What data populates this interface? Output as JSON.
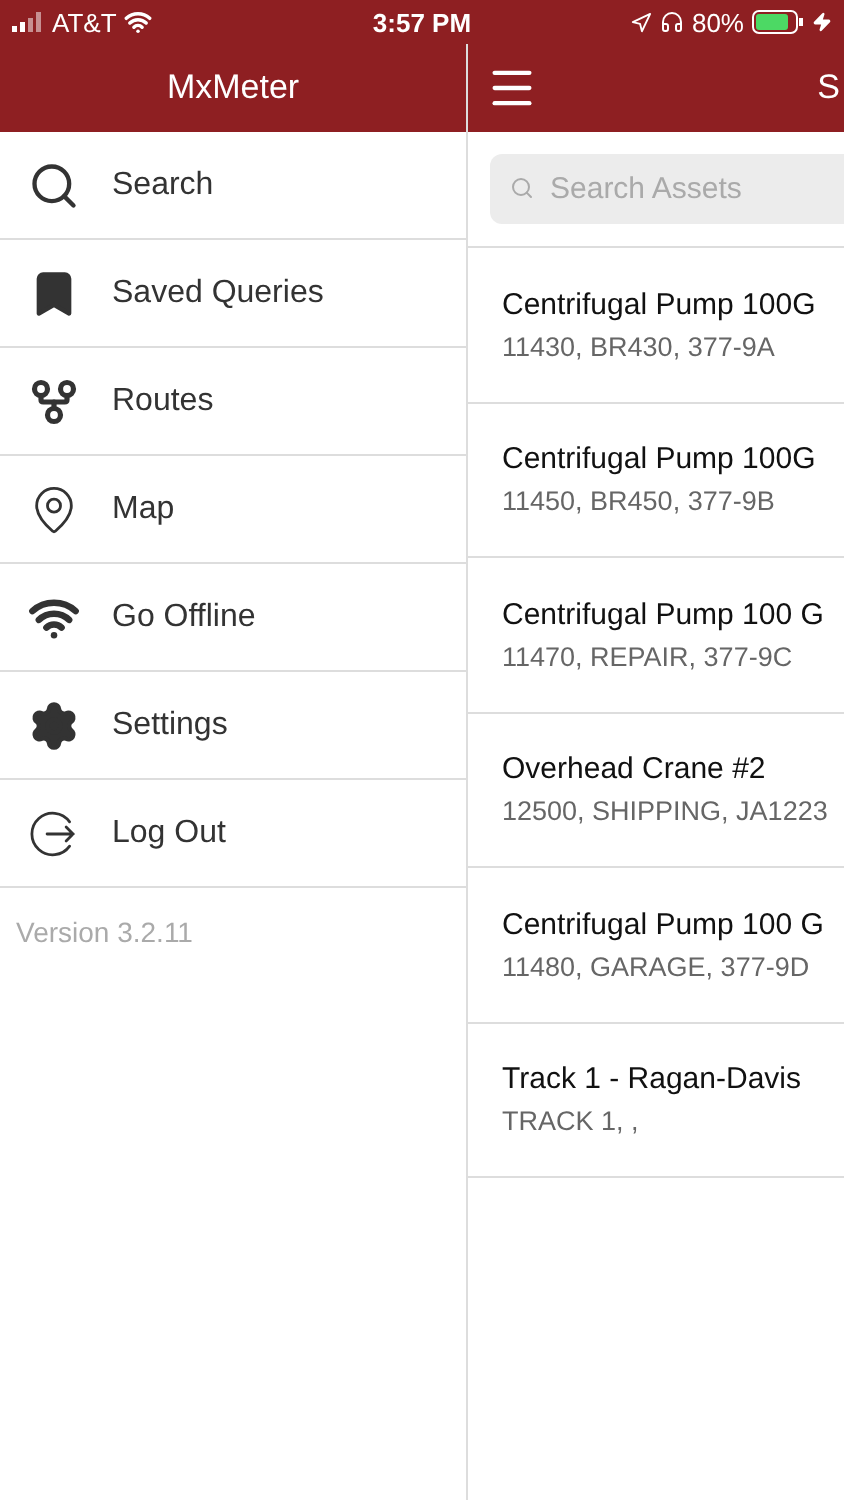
{
  "status_bar": {
    "carrier": "AT&T",
    "time": "3:57 PM",
    "battery": "80%"
  },
  "drawer": {
    "title": "MxMeter",
    "items": [
      {
        "label": "Search"
      },
      {
        "label": "Saved Queries"
      },
      {
        "label": "Routes"
      },
      {
        "label": "Map"
      },
      {
        "label": "Go Offline"
      },
      {
        "label": "Settings"
      },
      {
        "label": "Log Out"
      }
    ],
    "version": "Version 3.2.11"
  },
  "main": {
    "title": "S",
    "search": {
      "placeholder": "Search Assets"
    },
    "assets": [
      {
        "name": "Centrifugal Pump 100G",
        "details": "11430, BR430, 377-9A"
      },
      {
        "name": "Centrifugal Pump 100G",
        "details": "11450, BR450, 377-9B"
      },
      {
        "name": "Centrifugal Pump 100 G",
        "details": "11470, REPAIR, 377-9C"
      },
      {
        "name": "Overhead Crane #2",
        "details": "12500, SHIPPING, JA1223"
      },
      {
        "name": "Centrifugal Pump 100 G",
        "details": "11480, GARAGE, 377-9D"
      },
      {
        "name": "Track 1 - Ragan-Davis",
        "details": "TRACK 1, ,"
      }
    ]
  }
}
